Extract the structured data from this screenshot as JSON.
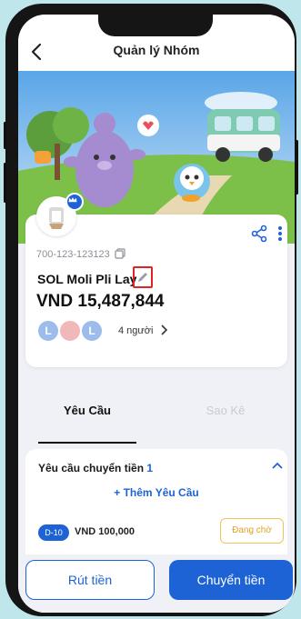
{
  "header": {
    "title": "Quản lý Nhóm"
  },
  "group": {
    "account_number": "700-123-123123",
    "name": "SOL Moli Pli Lay",
    "balance": "VND 15,487,844",
    "members": [
      "L",
      "",
      "L"
    ],
    "member_count": "4 người"
  },
  "tabs": {
    "requests": "Yêu Cầu",
    "statement": "Sao Kê"
  },
  "requests": {
    "title": "Yêu cầu chuyển tiền",
    "count": "1",
    "add_label": "+ Thêm Yêu Cầu",
    "items": [
      {
        "badge": "D-10",
        "amount": "VND 100,000",
        "status": "Đang chờ"
      }
    ]
  },
  "actions": {
    "withdraw": "Rút tiền",
    "transfer": "Chuyển tiền"
  },
  "colors": {
    "primary": "#1e63d6",
    "pending": "#e0a321",
    "highlight": "#e02424"
  }
}
